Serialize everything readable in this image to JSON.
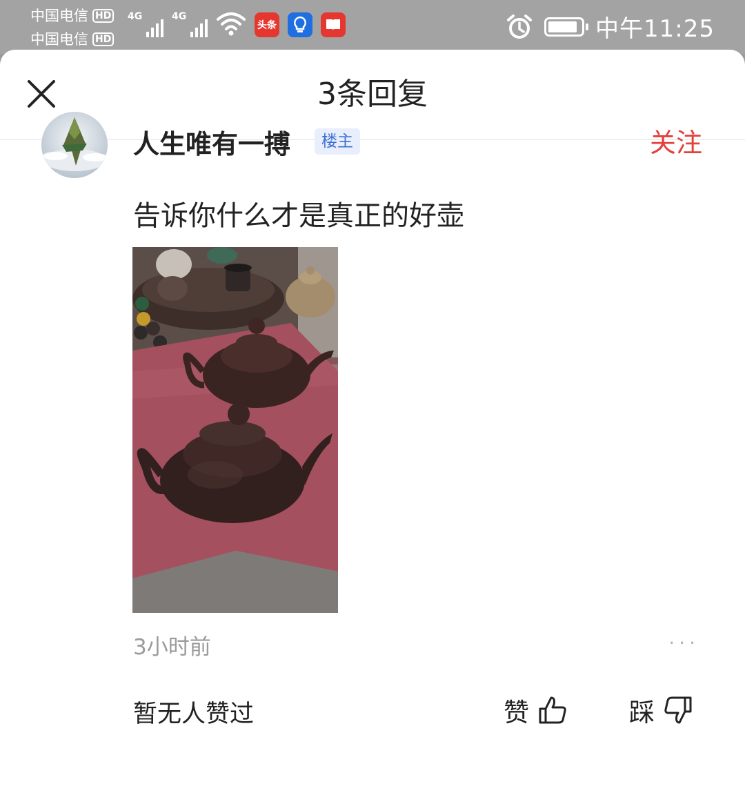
{
  "status_bar": {
    "carrier_1": "中国电信",
    "carrier_2": "中国电信",
    "hd_label": "HD",
    "network_1": "4G",
    "network_2": "4G",
    "app_icon_toutiao": "头条",
    "time": "中午11:25",
    "battery_level_pct": 90
  },
  "sheet": {
    "title": "3条回复",
    "close_icon": "close-icon"
  },
  "comment": {
    "username": "人生唯有一搏",
    "badge": "楼主",
    "follow_label": "关注",
    "text": "告诉你什么才是真正的好壶",
    "time_ago": "3小时前",
    "more_label": "···",
    "no_likes_text": "暂无人赞过",
    "like_label": "赞",
    "dislike_label": "踩"
  },
  "colors": {
    "follow_red": "#e3413b",
    "badge_blue": "#3d6fd6",
    "badge_bg": "#e8eefb"
  }
}
